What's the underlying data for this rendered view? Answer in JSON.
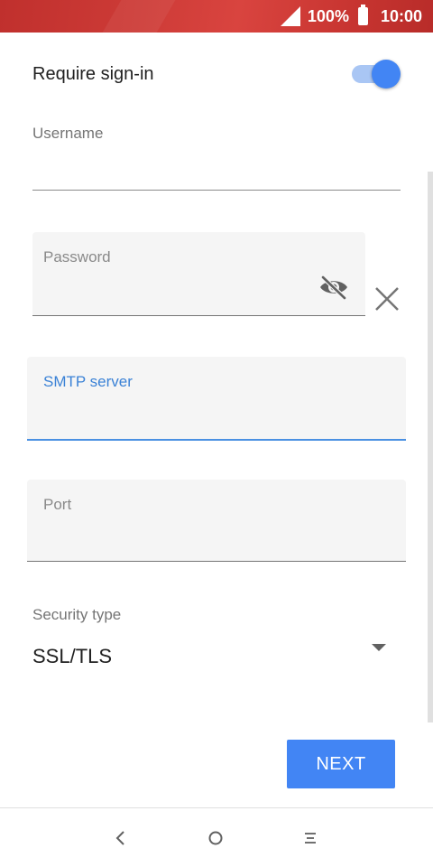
{
  "status_bar": {
    "battery": "100%",
    "time": "10:00"
  },
  "form": {
    "require_signin": {
      "label": "Require sign-in",
      "enabled": true
    },
    "username": {
      "label": "Username",
      "value": ""
    },
    "password": {
      "label": "Password",
      "value": ""
    },
    "smtp_server": {
      "label": "SMTP server",
      "value": "",
      "focused": true
    },
    "port": {
      "label": "Port",
      "value": ""
    },
    "security_type": {
      "label": "Security type",
      "value": "SSL/TLS"
    }
  },
  "actions": {
    "next_label": "NEXT"
  },
  "icons": {
    "signal": "signal-icon",
    "battery": "battery-icon",
    "password_visibility": "eye-off-icon",
    "clear": "close-icon",
    "dropdown": "dropdown-arrow-icon",
    "nav_back": "back-icon",
    "nav_home": "home-icon",
    "nav_menu": "menu-icon"
  },
  "colors": {
    "accent": "#4285f4",
    "status_bar": "#c9383a",
    "focus_underline": "#4a90e2"
  }
}
